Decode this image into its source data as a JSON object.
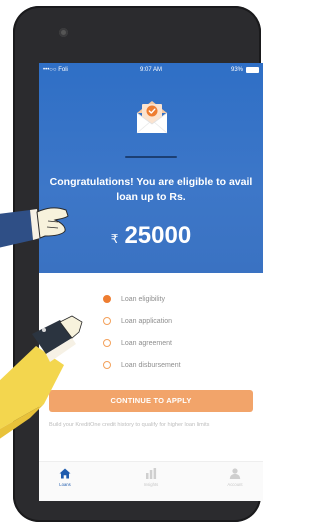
{
  "status_bar": {
    "carrier": "•••○○ Foli",
    "time": "9:07 AM",
    "battery": "93%"
  },
  "hero": {
    "message": "Congratulations! You are eligible to avail loan up to Rs.",
    "currency_symbol": "₹",
    "amount": "25000"
  },
  "steps": [
    {
      "label": "Loan eligibility",
      "completed": true
    },
    {
      "label": "Loan application",
      "completed": false
    },
    {
      "label": "Loan agreement",
      "completed": false
    },
    {
      "label": "Loan disbursement",
      "completed": false
    }
  ],
  "cta_label": "CONTINUE TO APPLY",
  "hint": "Build your KreditOne credit history to qualify for higher loan limits",
  "nav": [
    {
      "label": "Loans",
      "icon": "home-icon",
      "active": true
    },
    {
      "label": "Insights",
      "icon": "chart-icon",
      "active": false
    },
    {
      "label": "Account",
      "icon": "profile-icon",
      "active": false
    }
  ],
  "colors": {
    "primary_blue": "#3a72c2",
    "accent_orange": "#ee7d31",
    "button_orange": "#f2a46a"
  }
}
